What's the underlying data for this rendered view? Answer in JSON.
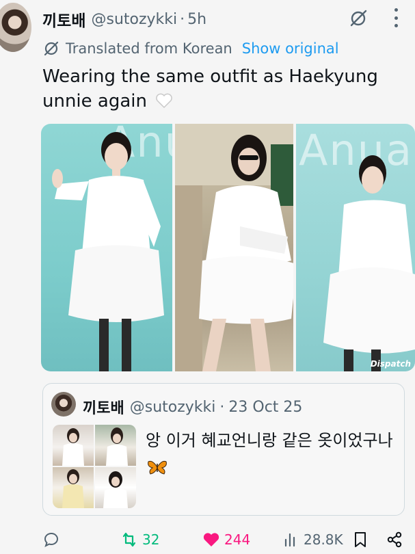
{
  "tweet": {
    "author": {
      "display_name": "끼토배",
      "handle": "@sutozykki"
    },
    "separator": "·",
    "time": "5h",
    "translation": {
      "label": "Translated from Korean",
      "show_original": "Show original"
    },
    "text": "Wearing the same outfit as Haekyung unnie again",
    "photos": [
      {
        "background_text": "Anu",
        "watermark": ""
      },
      {
        "background_text": "",
        "watermark": ""
      },
      {
        "background_text": "Anua",
        "watermark": "Dispatch"
      }
    ]
  },
  "quote": {
    "author": {
      "display_name": "끼토배",
      "handle": "@sutozykki"
    },
    "separator": "·",
    "date": "23 Oct 25",
    "text": "앙 이거 혜교언니랑 같은 옷이었구나"
  },
  "actions": {
    "retweets": "32",
    "likes": "244",
    "views": "28.8K"
  },
  "colors": {
    "accent": "#1d9bf0",
    "retweet": "#00ba7c",
    "like": "#f91880",
    "muted": "#536471"
  },
  "icons": [
    "grok-icon",
    "more-icon",
    "translate-icon",
    "white-heart-emoji",
    "butterfly-emoji",
    "reply-icon",
    "retweet-icon",
    "like-icon",
    "views-icon",
    "bookmark-icon",
    "share-icon"
  ]
}
